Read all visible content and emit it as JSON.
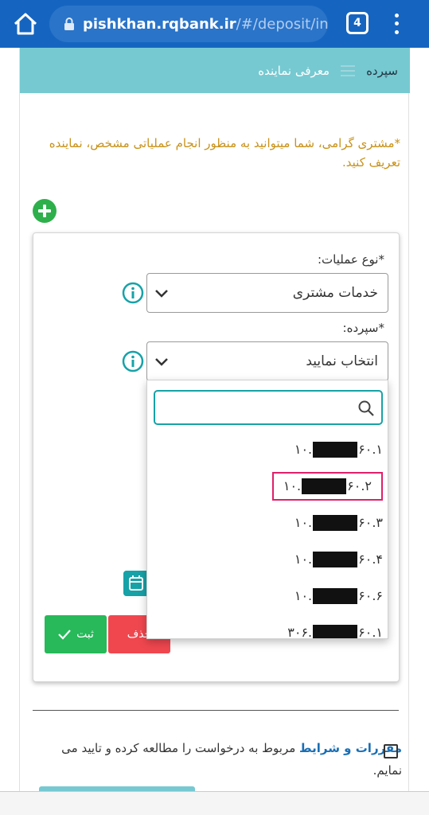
{
  "browser": {
    "url_domain": "pishkhan.rqbank.ir",
    "url_path": "/#/deposit/int",
    "tab_count": "4"
  },
  "header": {
    "section": "سپرده",
    "title": "معرفی نماینده"
  },
  "notice": "*مشتری گرامی، شما میتوانید به منظور انجام عملیاتی مشخص، نماینده تعریف کنید.",
  "form": {
    "operation_label": "*نوع عملیات:",
    "operation_value": "خدمات مشتری",
    "deposit_label": "*سپرده:",
    "deposit_value": "انتخاب نمایید",
    "delete_label": "حذف",
    "submit_label": "ثبت"
  },
  "dropdown": {
    "options": [
      {
        "prefix": "۱۰.",
        "suffix": "۶۰.۱"
      },
      {
        "prefix": "۱۰.",
        "suffix": "۶۰.۲"
      },
      {
        "prefix": "۱۰.",
        "suffix": "۶۰.۳"
      },
      {
        "prefix": "۱۰.",
        "suffix": "۶۰.۴"
      },
      {
        "prefix": "۱۰.",
        "suffix": "۶۰.۶"
      },
      {
        "prefix": "۳۰۶.",
        "suffix": "۶۰.۱"
      }
    ],
    "highlighted_index": 1
  },
  "terms": {
    "link": "مقررات و شرایط",
    "text": " مربوط به درخواست را مطالعه کرده و تایید می نمایم."
  },
  "colors": {
    "header_bg": "#76c9d1",
    "browser_bar": "#1565c0",
    "notice": "#c8921a",
    "highlight": "#e0206a",
    "teal": "#17a2a8"
  }
}
